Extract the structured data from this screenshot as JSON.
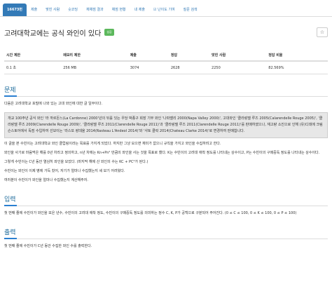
{
  "tabs": [
    "16673번",
    "제출",
    "맞힌 사람",
    "숏코딩",
    "재채점 결과",
    "채점 현황",
    "내 제출",
    "☑ 난이도 기여",
    "질문 검색"
  ],
  "problem": {
    "title": "고려대학교에는 공식 와인이 있다",
    "tag": "성공",
    "star_icon": "star-icon"
  },
  "table": {
    "headers": [
      "시간 제한",
      "메모리 제한",
      "제출",
      "정답",
      "맞힌 사람",
      "정답 비율"
    ],
    "row": [
      "0.1 초",
      "256 MB",
      "3074",
      "2628",
      "2250",
      "82.569%"
    ]
  },
  "sections": {
    "problem": "문제",
    "input": "입력",
    "output": "출력"
  },
  "text": {
    "intro": "다음은 고려대학교 포털에 나와 있는 고대 와인에 대한 글 일부이다.",
    "quote": "개교 100주년 공식 와인 '라 까르돈느(La Cardonne) 2000'년의 뒤를 잇는 우당 박종구 회장 기부 와인 '나파밸리 2000(Napa Valley 2000)', 고대와인 '클라랑델 루즈 2005(Calarendelle Rouge 2005)', '클라랑델 루즈 2009(Clarendelle Rouge 2009)', '클라랑델 루즈 2011(Clarendelle Rouge 2011)'과 '클라랑델 루즈 2011(Clarendelle Rouge 2011)'를 판매하였으나, 재고량 소진으로 인해 (유)디데에 크림슨스토어에서 독점 수입하여 선보이는 '라스또 랑데올 2014(Rasteau L'Andeol 2014)'와 '샤토 클락 2014(Chateau Clarke 2014)'로 변경하여 판매합니다.",
    "p1": "이 글을 본 수빈이는 고려대학교 와인 클럽링이라는 목표를 가지게 되었다. 하지만 그냥 모으면 재미가 없으니 규칙을 가지고 와인을 수집하려고 한다.",
    "p2": "와인을 사기로 마음먹은 해를 0년 차라고 정의하고, n년 차에는 Kn+Pn² 만큼의 와인을 사는 것을 목표로 했다. K는 수빈이의 고려대 애착 정도를 나타내는 상수이고, P는 수빈이의 구매중독 정도를 나타내는 상수이다.",
    "p3": "그렇게 수빈이는 C년 동안 열심히 와인을 모았다. (마지막 해에 산 와인의 수는 KC + PC²가 된다.)",
    "p4": "수빈이는 와인이 이제 병에 가득 찼어, 자기가 얼마나 수집했는지 세 보기 어려웠다.",
    "p5": "여러분이 수빈이가 와인을 얼마나 수집했는지 계산해주자.",
    "input": "첫 번째 줄에 수빈이가 와인을 모은 년수, 수빈이의 고려대 애착 정도, 수빈이의 구매중독 정도를 의미하는 정수 C, K, P가 공백으로 구분되어 주어진다. (0 ≤ C ≤ 100, 0 ≤ K ≤ 100, 0 ≤ P ≤ 100)",
    "output": "첫 번째 줄에 수빈이가 C년 동안 수집한 와인 수를 출력한다."
  }
}
